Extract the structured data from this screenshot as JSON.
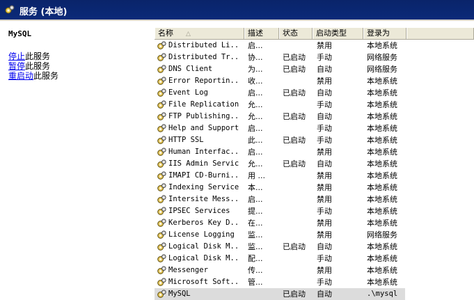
{
  "window": {
    "title": "服务 (本地)"
  },
  "left_pane": {
    "service_name": "MySQL",
    "actions": [
      {
        "link": "停止",
        "suffix": "此服务"
      },
      {
        "link": "暂停",
        "suffix": "此服务"
      },
      {
        "link": "重启动",
        "suffix": "此服务"
      }
    ]
  },
  "columns": {
    "name": "名称",
    "sort_indicator": "△",
    "description": "描述",
    "status": "状态",
    "startup": "启动类型",
    "logon": "登录为"
  },
  "rows": [
    {
      "name": "Distributed Li...",
      "desc": "启...",
      "status": "",
      "startup": "禁用",
      "logon": "本地系统"
    },
    {
      "name": "Distributed Tr...",
      "desc": "协...",
      "status": "已启动",
      "startup": "手动",
      "logon": "网络服务"
    },
    {
      "name": "DNS Client",
      "desc": "为...",
      "status": "已启动",
      "startup": "自动",
      "logon": "网络服务"
    },
    {
      "name": "Error Reportin...",
      "desc": "收...",
      "status": "",
      "startup": "禁用",
      "logon": "本地系统"
    },
    {
      "name": "Event Log",
      "desc": "启...",
      "status": "已启动",
      "startup": "自动",
      "logon": "本地系统"
    },
    {
      "name": "File Replication",
      "desc": "允...",
      "status": "",
      "startup": "手动",
      "logon": "本地系统"
    },
    {
      "name": "FTP Publishing...",
      "desc": "允...",
      "status": "已启动",
      "startup": "自动",
      "logon": "本地系统"
    },
    {
      "name": "Help and Support",
      "desc": "启...",
      "status": "",
      "startup": "手动",
      "logon": "本地系统"
    },
    {
      "name": "HTTP SSL",
      "desc": "此...",
      "status": "已启动",
      "startup": "手动",
      "logon": "本地系统"
    },
    {
      "name": "Human Interfac...",
      "desc": "启...",
      "status": "",
      "startup": "禁用",
      "logon": "本地系统"
    },
    {
      "name": "IIS Admin Service",
      "desc": "允...",
      "status": "已启动",
      "startup": "自动",
      "logon": "本地系统"
    },
    {
      "name": "IMAPI CD-Burni...",
      "desc": "用 ...",
      "status": "",
      "startup": "禁用",
      "logon": "本地系统"
    },
    {
      "name": "Indexing Service",
      "desc": "本...",
      "status": "",
      "startup": "禁用",
      "logon": "本地系统"
    },
    {
      "name": "Intersite Mess...",
      "desc": "启...",
      "status": "",
      "startup": "禁用",
      "logon": "本地系统"
    },
    {
      "name": "IPSEC Services",
      "desc": "提...",
      "status": "",
      "startup": "手动",
      "logon": "本地系统"
    },
    {
      "name": "Kerberos Key D...",
      "desc": "在...",
      "status": "",
      "startup": "禁用",
      "logon": "本地系统"
    },
    {
      "name": "License Logging",
      "desc": "监...",
      "status": "",
      "startup": "禁用",
      "logon": "网络服务"
    },
    {
      "name": "Logical Disk M...",
      "desc": "监...",
      "status": "已启动",
      "startup": "自动",
      "logon": "本地系统"
    },
    {
      "name": "Logical Disk M...",
      "desc": "配...",
      "status": "",
      "startup": "手动",
      "logon": "本地系统"
    },
    {
      "name": "Messenger",
      "desc": "传...",
      "status": "",
      "startup": "禁用",
      "logon": "本地系统"
    },
    {
      "name": "Microsoft Soft...",
      "desc": "管...",
      "status": "",
      "startup": "手动",
      "logon": "本地系统"
    },
    {
      "name": "MySQL",
      "desc": "",
      "status": "已启动",
      "startup": "自动",
      "logon": ".\\mysql",
      "selected": true
    }
  ],
  "colors": {
    "title_bar": "#0a246a",
    "header_bg": "#ece9d8",
    "selected_row": "#dcdcdc",
    "link": "#0000ee"
  }
}
